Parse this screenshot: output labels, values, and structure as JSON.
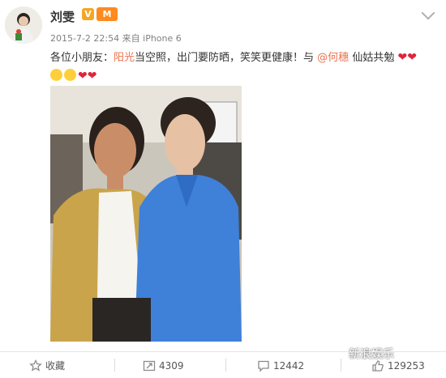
{
  "post": {
    "username": "刘雯",
    "verified_badge": "V",
    "member_badge": "M",
    "timestamp": "2015-7-2 22:54",
    "source_prefix": "来自",
    "source": "iPhone 6",
    "text_part1": "各位小朋友：",
    "link1": "阳光",
    "text_part2": "当空照，出门要防晒，笑笑更健康！与 ",
    "link2": "@何穗",
    "text_part3": " 仙姑共勉"
  },
  "footer": {
    "favorite_label": "收藏",
    "repost_count": "4309",
    "comment_count": "12442",
    "like_count": "129253"
  },
  "watermark": "新浪娱乐",
  "colors": {
    "link": "#eb7350",
    "heart": "#e0243a",
    "verified": "#f6a623"
  },
  "icons": [
    "star-icon",
    "repost-icon",
    "comment-icon",
    "like-icon",
    "chevron-down-icon",
    "heart-icon",
    "smile-icon"
  ]
}
